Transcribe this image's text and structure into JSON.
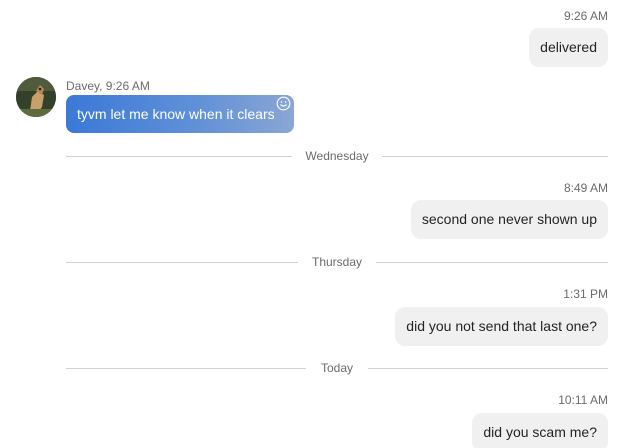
{
  "messages": [
    {
      "time": "9:26 AM",
      "text": "delivered"
    },
    {
      "time": "8:49 AM",
      "text": "second one never shown up"
    },
    {
      "time": "1:31 PM",
      "text": "did you not send that last one?"
    },
    {
      "time": "10:11 AM",
      "text": "did you scam me?"
    }
  ],
  "incoming": {
    "sender_line": "Davey, 9:26 AM",
    "text": "tyvm let me know when it clears",
    "avatar_icon": "avatar-photo-icon",
    "react_icon": "smiley-face-icon"
  },
  "dividers": [
    "Wednesday",
    "Thursday",
    "Today"
  ],
  "colors": {
    "incoming_bubble": "#3a79d6",
    "outgoing_bubble": "#f0f0f0"
  }
}
